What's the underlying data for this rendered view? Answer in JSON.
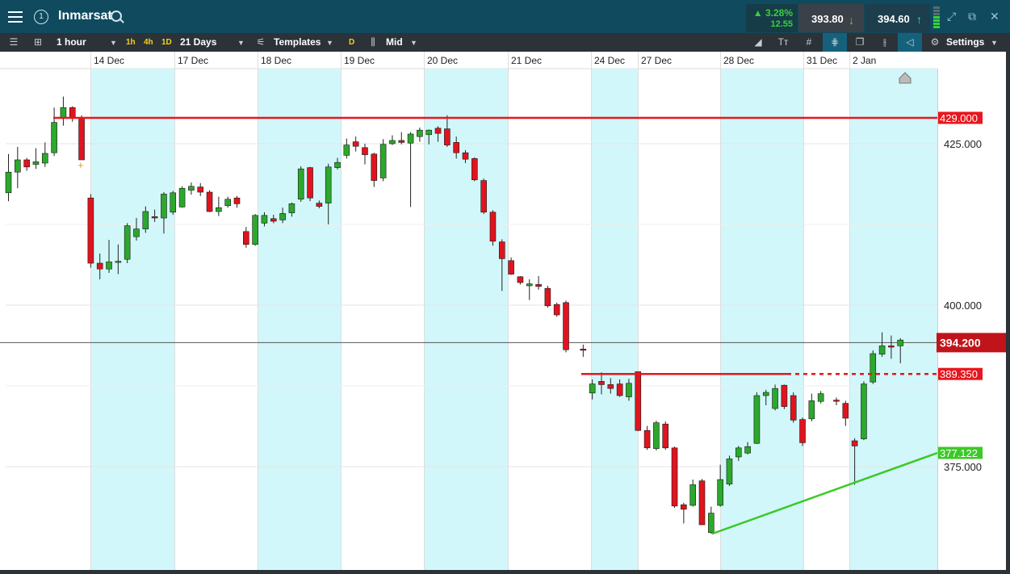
{
  "header": {
    "title": "Inmarsat",
    "change_pct": "3.28%",
    "change_abs": "12.55",
    "sell_price": "393.80",
    "buy_price": "394.60",
    "window_number": "1"
  },
  "toolbar": {
    "interval": "1 hour",
    "quick_intervals": [
      "1h",
      "4h",
      "1D"
    ],
    "range": "21 Days",
    "templates_label": "Templates",
    "d_label": "D",
    "price_type": "Mid",
    "settings_label": "Settings"
  },
  "colors": {
    "up_candle": "#2ca82c",
    "down_candle": "#e0141e",
    "shade": "#d2f7fa",
    "resistance": "#e8161e",
    "trendline": "#3cc928",
    "current_price": "#c0141a"
  },
  "chart_data": {
    "type": "candlestick",
    "ylim": [
      362.5,
      441.5
    ],
    "y_ticks": [
      "425.000",
      "400.000",
      "375.000"
    ],
    "x_date_labels": [
      "14 Dec",
      "17 Dec",
      "18 Dec",
      "19 Dec",
      "20 Dec",
      "21 Dec",
      "24 Dec",
      "27 Dec",
      "28 Dec",
      "31 Dec",
      "2 Jan"
    ],
    "current_price": 394.2,
    "current_price_label": "394.200",
    "horizontal_levels": [
      {
        "value": 429.0,
        "label": "429.000",
        "style": "solid"
      },
      {
        "value": 389.35,
        "label": "389.350",
        "style": "solid-then-dashed"
      }
    ],
    "trendline": {
      "from_value": 364.6,
      "to_value": 377.122,
      "label": "377.122"
    },
    "candles": [
      [
        417.4,
        420.6,
        416.1,
        423.4
      ],
      [
        420.6,
        422.5,
        418.1,
        424.5
      ],
      [
        422.5,
        421.4,
        420.8,
        422.8
      ],
      [
        421.8,
        422.2,
        421.1,
        424.3
      ],
      [
        422.0,
        423.5,
        421.4,
        425.2
      ],
      [
        423.6,
        428.3,
        423.1,
        430.6
      ],
      [
        429.0,
        430.6,
        427.8,
        432.3
      ],
      [
        430.6,
        429.0,
        428.4,
        430.8
      ],
      [
        429.0,
        422.5,
        422.5,
        429.4
      ],
      [
        416.6,
        406.5,
        405.8,
        417.2
      ],
      [
        406.5,
        405.6,
        404.0,
        408.0
      ],
      [
        405.6,
        406.7,
        405.0,
        410.1
      ],
      [
        406.7,
        406.8,
        404.8,
        409.4
      ],
      [
        407.1,
        412.3,
        406.5,
        412.7
      ],
      [
        410.6,
        411.8,
        410.0,
        413.5
      ],
      [
        411.8,
        414.5,
        411.2,
        415.3
      ],
      [
        413.7,
        413.5,
        412.9,
        414.8
      ],
      [
        413.5,
        417.2,
        411.1,
        417.5
      ],
      [
        414.4,
        417.4,
        414.0,
        417.7
      ],
      [
        415.2,
        418.1,
        415.1,
        418.4
      ],
      [
        417.8,
        418.4,
        417.1,
        419.0
      ],
      [
        418.3,
        417.5,
        416.9,
        418.9
      ],
      [
        417.5,
        414.5,
        414.4,
        417.8
      ],
      [
        414.5,
        415.1,
        413.8,
        416.8
      ],
      [
        415.4,
        416.4,
        415.1,
        416.8
      ],
      [
        416.6,
        415.7,
        415.1,
        416.9
      ],
      [
        411.4,
        409.4,
        408.9,
        412.1
      ],
      [
        409.4,
        413.9,
        409.2,
        414.1
      ],
      [
        412.7,
        413.9,
        412.2,
        414.4
      ],
      [
        413.4,
        413.0,
        412.7,
        414.0
      ],
      [
        413.2,
        414.2,
        412.7,
        415.1
      ],
      [
        414.3,
        415.7,
        413.7,
        415.9
      ],
      [
        416.4,
        421.1,
        416.0,
        421.5
      ],
      [
        421.3,
        416.6,
        416.1,
        421.4
      ],
      [
        415.8,
        415.3,
        415.0,
        416.2
      ],
      [
        415.8,
        421.4,
        412.5,
        421.9
      ],
      [
        421.3,
        422.1,
        421.0,
        422.8
      ],
      [
        423.2,
        424.8,
        422.7,
        425.8
      ],
      [
        425.3,
        424.6,
        423.8,
        426.1
      ],
      [
        424.4,
        423.3,
        421.8,
        425.0
      ],
      [
        423.4,
        419.3,
        418.3,
        423.6
      ],
      [
        419.7,
        424.9,
        419.2,
        425.7
      ],
      [
        425.0,
        425.5,
        424.8,
        426.3
      ],
      [
        425.5,
        425.2,
        424.9,
        426.8
      ],
      [
        425.1,
        426.5,
        415.2,
        426.8
      ],
      [
        426.1,
        427.1,
        425.3,
        427.5
      ],
      [
        426.4,
        427.1,
        424.9,
        427.2
      ],
      [
        427.4,
        426.6,
        425.3,
        427.7
      ],
      [
        427.3,
        424.8,
        424.5,
        429.4
      ],
      [
        425.2,
        423.6,
        422.7,
        426.1
      ],
      [
        423.6,
        422.6,
        422.0,
        424.0
      ],
      [
        422.7,
        419.4,
        419.2,
        422.9
      ],
      [
        419.3,
        414.4,
        414.1,
        419.6
      ],
      [
        414.4,
        409.9,
        409.2,
        414.7
      ],
      [
        409.8,
        407.2,
        402.2,
        410.2
      ],
      [
        406.9,
        404.8,
        404.7,
        407.4
      ],
      [
        404.4,
        403.5,
        403.2,
        404.5
      ],
      [
        403.0,
        403.3,
        400.8,
        404.0
      ],
      [
        403.2,
        402.9,
        402.4,
        404.5
      ],
      [
        402.6,
        399.9,
        399.6,
        403.0
      ],
      [
        400.1,
        398.5,
        398.2,
        400.4
      ],
      [
        400.4,
        393.1,
        392.7,
        400.7
      ],
      [
        393.2,
        393.1,
        392.0,
        393.9
      ],
      [
        386.4,
        387.8,
        385.4,
        388.5
      ],
      [
        388.2,
        387.7,
        386.2,
        389.6
      ],
      [
        387.7,
        387.1,
        386.3,
        388.7
      ],
      [
        387.8,
        386.0,
        385.8,
        388.5
      ],
      [
        385.8,
        387.9,
        385.2,
        388.6
      ],
      [
        389.7,
        380.6,
        380.5,
        389.7
      ],
      [
        380.6,
        377.9,
        377.6,
        381.3
      ],
      [
        377.8,
        381.8,
        377.5,
        382.1
      ],
      [
        381.6,
        377.9,
        377.6,
        382.0
      ],
      [
        377.9,
        368.9,
        368.6,
        378.1
      ],
      [
        369.1,
        368.4,
        366.2,
        369.4
      ],
      [
        369.0,
        372.2,
        368.8,
        373.0
      ],
      [
        372.8,
        366.0,
        366.0,
        373.1
      ],
      [
        364.8,
        367.8,
        364.6,
        368.8
      ],
      [
        369.0,
        373.0,
        368.8,
        375.3
      ],
      [
        372.3,
        376.2,
        372.0,
        376.7
      ],
      [
        376.5,
        377.9,
        375.9,
        378.2
      ],
      [
        377.1,
        378.1,
        376.9,
        378.8
      ],
      [
        378.6,
        386.0,
        378.5,
        386.5
      ],
      [
        386.0,
        386.5,
        384.5,
        386.9
      ],
      [
        384.0,
        387.1,
        383.7,
        387.7
      ],
      [
        387.6,
        384.3,
        383.9,
        387.7
      ],
      [
        386.0,
        382.2,
        381.8,
        386.5
      ],
      [
        382.3,
        378.7,
        378.2,
        382.6
      ],
      [
        382.4,
        385.2,
        382.0,
        386.3
      ],
      [
        385.1,
        386.3,
        384.8,
        386.7
      ],
      [
        385.3,
        385.2,
        384.5,
        385.7
      ],
      [
        384.8,
        382.5,
        381.3,
        385.2
      ],
      [
        379.0,
        378.2,
        372.2,
        379.4
      ],
      [
        379.3,
        387.8,
        379.1,
        388.2
      ],
      [
        388.1,
        392.5,
        387.8,
        393.0
      ],
      [
        392.4,
        393.7,
        392.0,
        395.8
      ],
      [
        393.7,
        393.5,
        391.7,
        395.3
      ],
      [
        393.7,
        394.6,
        391.0,
        394.9
      ]
    ]
  }
}
